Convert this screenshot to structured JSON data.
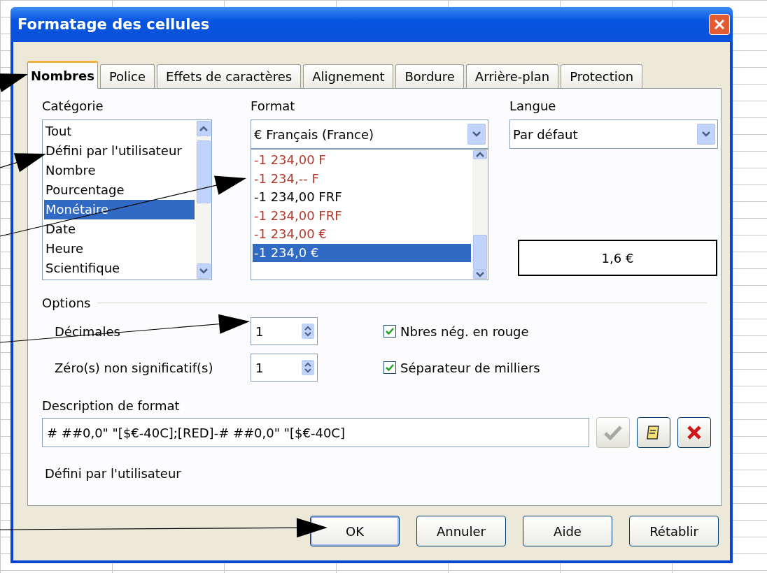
{
  "window": {
    "title": "Formatage des cellules"
  },
  "tabs": [
    {
      "label": "Nombres",
      "selected": true
    },
    {
      "label": "Police",
      "selected": false
    },
    {
      "label": "Effets de caractères",
      "selected": false
    },
    {
      "label": "Alignement",
      "selected": false
    },
    {
      "label": "Bordure",
      "selected": false
    },
    {
      "label": "Arrière-plan",
      "selected": false
    },
    {
      "label": "Protection",
      "selected": false
    }
  ],
  "category": {
    "label": "Catégorie",
    "items": [
      {
        "text": "Tout",
        "selected": false
      },
      {
        "text": "Défini par l'utilisateur",
        "selected": false
      },
      {
        "text": "Nombre",
        "selected": false
      },
      {
        "text": "Pourcentage",
        "selected": false
      },
      {
        "text": "Monétaire",
        "selected": true
      },
      {
        "text": "Date",
        "selected": false
      },
      {
        "text": "Heure",
        "selected": false
      },
      {
        "text": "Scientifique",
        "selected": false
      }
    ]
  },
  "format": {
    "label": "Format",
    "value": "€ Français (France)",
    "items": [
      {
        "text": "-1 234,00 F",
        "color": "#b03a2e",
        "selected": false
      },
      {
        "text": "-1 234,-- F",
        "color": "#b03a2e",
        "selected": false
      },
      {
        "text": "-1 234,00 FRF",
        "color": "#000000",
        "selected": false
      },
      {
        "text": "-1 234,00 FRF",
        "color": "#b03a2e",
        "selected": false
      },
      {
        "text": "-1 234,00 €",
        "color": "#b03a2e",
        "selected": false
      },
      {
        "text": "-1 234,0 €",
        "color": "#ffffff",
        "selected": true
      }
    ]
  },
  "language": {
    "label": "Langue",
    "value": "Par défaut"
  },
  "preview": "1,6 €",
  "options": {
    "title": "Options",
    "spinners": [
      {
        "label": "Décimales",
        "value": "1"
      },
      {
        "label": "Zéro(s) non significatif(s)",
        "value": "1"
      }
    ],
    "checkboxes": [
      {
        "label": "Nbres nég. en rouge",
        "checked": true
      },
      {
        "label": "Séparateur de milliers",
        "checked": true
      }
    ]
  },
  "description": {
    "label": "Description de format",
    "value": "# ##0,0\" \"[$€-40C];[RED]-# ##0,0\" \"[$€-40C]",
    "accept_disabled": true,
    "note": "Défini par l'utilisateur"
  },
  "buttons": [
    {
      "label": "OK",
      "default": true
    },
    {
      "label": "Annuler",
      "default": false
    },
    {
      "label": "Aide",
      "default": false
    },
    {
      "label": "Rétablir",
      "default": false
    }
  ]
}
